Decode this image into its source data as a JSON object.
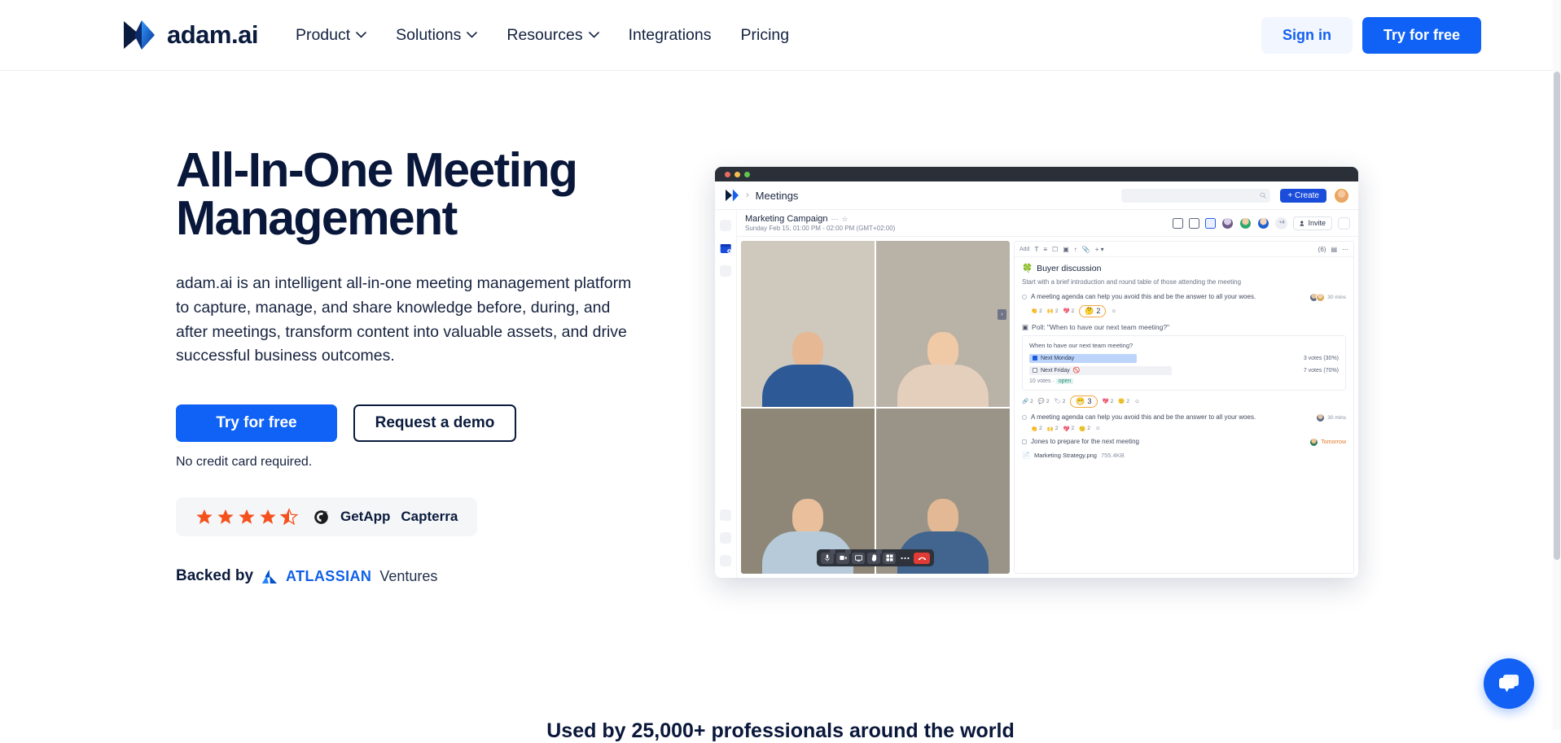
{
  "nav": {
    "brand": "adam.ai",
    "brand_logo_icon": "adam-ai-logo-icon",
    "links": [
      {
        "label": "Product",
        "has_dropdown": true
      },
      {
        "label": "Solutions",
        "has_dropdown": true
      },
      {
        "label": "Resources",
        "has_dropdown": true
      },
      {
        "label": "Integrations",
        "has_dropdown": false
      },
      {
        "label": "Pricing",
        "has_dropdown": false
      }
    ],
    "sign_in": "Sign in",
    "try_free": "Try for free"
  },
  "hero": {
    "title": "All-In-One Meeting Management",
    "subtitle": "adam.ai is an intelligent all-in-one meeting management platform to capture, manage, and share knowledge before, during, and after meetings, transform content into valuable assets, and drive successful business outcomes.",
    "cta_primary": "Try for free",
    "cta_secondary": "Request a demo",
    "no_card": "No credit card required.",
    "rating": {
      "stars_filled": 4,
      "stars_half": 1,
      "stars_total": 5,
      "star_color": "#f4511e",
      "g2_label": "G2",
      "getapp_label": "GetApp",
      "capterra_label": "Capterra"
    },
    "backed": {
      "prefix": "Backed by",
      "brand": "ATLASSIAN",
      "suffix": "Ventures"
    }
  },
  "mockup": {
    "window_dots": [
      "red",
      "yellow",
      "green"
    ],
    "breadcrumb": "Meetings",
    "search_placeholder": "",
    "create_button": "+ Create",
    "meeting": {
      "title": "Marketing Campaign",
      "datetime": "Sunday Feb 15, 01:00 PM - 02:00 PM (GMT+02:00)",
      "extra_members": "+4",
      "invite_label": "Invite"
    },
    "agenda": {
      "toolbar_left_label": "Add",
      "checklist_count": "(6)",
      "heading": "Buyer discussion",
      "intro": "Start with a brief introduction and round table of those attending the meeting",
      "item1": "A meeting agenda can help you avoid this and be the answer to all your woes.",
      "item1_time": "30 mins",
      "item1_reactions": [
        {
          "emoji": "👏",
          "count": "2"
        },
        {
          "emoji": "🙌",
          "count": "2"
        },
        {
          "emoji": "💖",
          "count": "2"
        }
      ],
      "item1_highlight": {
        "emoji": "🤔",
        "count": "2"
      },
      "poll_label": "Poll: \"When to have our next team meeting?\"",
      "poll_question": "When to have our next team meeting?",
      "poll_options": [
        {
          "label": "Next Monday",
          "votes": "3 votes (30%)",
          "selected": true,
          "percent": 30
        },
        {
          "label": "Next Friday",
          "votes": "7 votes (70%)",
          "selected": false,
          "percent": 70
        }
      ],
      "poll_footer_votes": "10 votes",
      "poll_footer_status": "open",
      "item2_reactions": [
        {
          "emoji": "🔗",
          "count": "2"
        },
        {
          "emoji": "💬",
          "count": "2"
        },
        {
          "emoji": "🏷",
          "count": "2"
        }
      ],
      "item2_highlight": {
        "emoji": "😁",
        "count": "3"
      },
      "item2_reactions_after": [
        {
          "emoji": "💖",
          "count": "2"
        },
        {
          "emoji": "🙂",
          "count": "2"
        }
      ],
      "item2": "A meeting agenda can help you avoid this and be the answer to all your woes.",
      "item2_time": "30 mins",
      "item2_sub_reactions": [
        {
          "emoji": "👏",
          "count": "2"
        },
        {
          "emoji": "🙌",
          "count": "2"
        },
        {
          "emoji": "💖",
          "count": "2"
        },
        {
          "emoji": "🙂",
          "count": "2"
        }
      ],
      "action_item": "Jones to prepare for the next meeting",
      "action_due": "Tomorrow",
      "file_name": "Marketing Strategy.png",
      "file_size": "755.4KB"
    },
    "video_controls": [
      "mic-icon",
      "camera-icon",
      "screen-share-icon",
      "raise-hand-icon",
      "grid-view-icon",
      "more-icon",
      "end-call-icon"
    ]
  },
  "bottom_text": "Used by 25,000+ professionals around the world",
  "chat_widget": {
    "icon": "chat-bubble-icon",
    "color": "#1260f4"
  },
  "colors": {
    "brand_blue": "#0f62f5",
    "navy": "#09173a",
    "star_orange": "#f4511e",
    "atlassian_blue": "#1060e8"
  }
}
